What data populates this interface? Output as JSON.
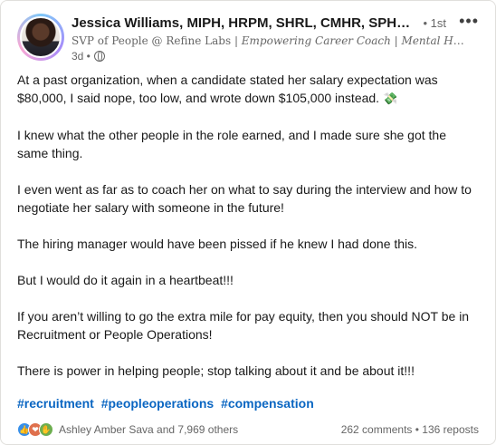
{
  "author": {
    "name": "Jessica Williams, MIPH, HRPM, SHRL, CMHR, SPHR, S...",
    "degree": "• 1st",
    "headline_role": "SVP of People @ Refine Labs",
    "headline_sep1": " | ",
    "headline_tag1": "Empowering Career Coach",
    "headline_sep2": " | ",
    "headline_tag2": "Mental Health Ent...",
    "time": "3d •",
    "visibility_icon": "globe-icon"
  },
  "more_label": "•••",
  "post": {
    "p1": "At a past organization, when a candidate stated her salary expectation was $80,000, I said nope, too low, and wrote down $105,000 instead.",
    "p1_emoji": "💸",
    "p2": "I knew what the other people in the role earned, and I made sure she got the same thing.",
    "p3": "I even went as far as to coach her on what to say during the interview and how to negotiate her salary with someone in the future!",
    "p4": "The hiring manager would have been pissed if he knew I had done this.",
    "p5": "But I would do it again in a heartbeat!!!",
    "p6": "If you aren’t willing to go the extra mile for pay equity, then you should NOT be in Recruitment or People Operations!",
    "p7": "There is power in helping people; stop talking about it and be about it!!!"
  },
  "hashtags": [
    "#recruitment",
    "#peopleoperations",
    "#compensation"
  ],
  "footer": {
    "reactions_text": "Ashley Amber Sava and 7,969 others",
    "comments": "262 comments",
    "sep": " • ",
    "reposts": "136 reposts",
    "reaction_icons": [
      "like-icon",
      "love-icon",
      "support-icon"
    ]
  },
  "colors": {
    "link": "#0a66c2",
    "text": "#191919",
    "muted": "#666666"
  }
}
